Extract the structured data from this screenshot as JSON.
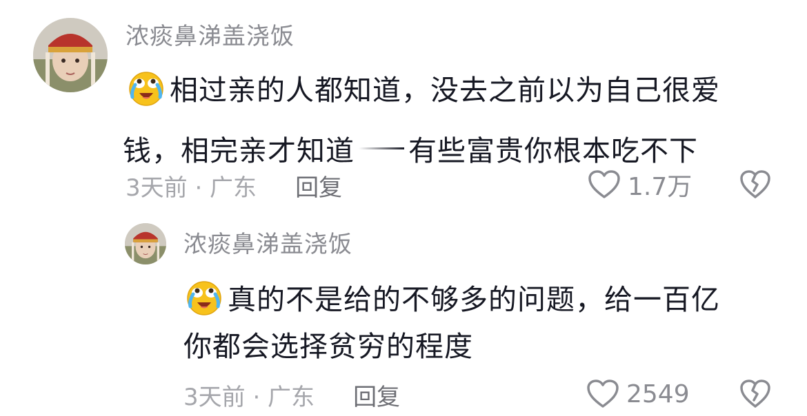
{
  "comments": [
    {
      "username": "浓痰鼻涕盖浇饭",
      "avatar_icon": "avatar-tang-monk-icon",
      "emoji_icon": "laughing-crying-emoji-icon",
      "line1": "相过亲的人都知道，没去之前以为自己很爱",
      "line2_a": "钱，相完亲才知道",
      "line2_b": "有些富贵你根本吃不下",
      "time_location": "3天前 · 广东",
      "reply_label": "回复",
      "like_count": "1.7万"
    },
    {
      "username": "浓痰鼻涕盖浇饭",
      "avatar_icon": "avatar-tang-monk-icon",
      "emoji_icon": "laughing-crying-emoji-icon",
      "line1": "真的不是给的不够多的问题，给一百亿",
      "line2": "你都会选择贫穷的程度",
      "time_location": "3天前 · 广东",
      "reply_label": "回复",
      "like_count": "2549"
    }
  ],
  "colors": {
    "username": "#8a8b91",
    "text": "#161823",
    "meta": "#a5a6ab",
    "reply": "#6d6e74",
    "icon": "#8a8b91"
  }
}
